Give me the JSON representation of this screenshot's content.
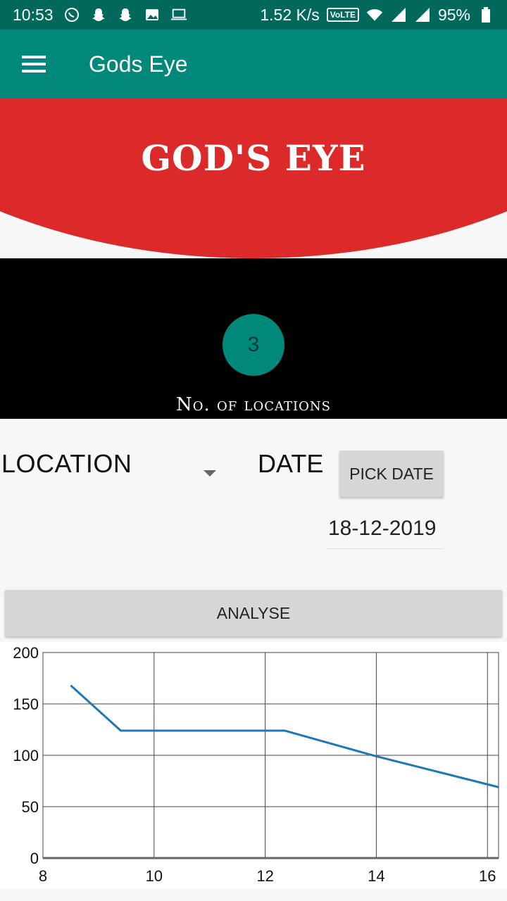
{
  "status_bar": {
    "time": "10:53",
    "speed": "1.52 K/s",
    "volte": "VoLTE",
    "battery": "95%"
  },
  "app_bar": {
    "title": "Gods Eye",
    "menu_icon": "hamburger-menu-icon"
  },
  "banner": {
    "title": "GOD'S EYE",
    "color": "#dc2a2a"
  },
  "summary": {
    "count": "3",
    "label": "No. of locations"
  },
  "form": {
    "location_label": "LOCATION",
    "date_label": "DATE",
    "pick_date_label": "PICK DATE",
    "date_value": "18-12-2019",
    "analyse_label": "ANALYSE"
  },
  "colors": {
    "primary": "#00897b",
    "primary_dark": "#00695c",
    "accent_red": "#dc2a2a",
    "line": "#1f77b4"
  },
  "chart_data": {
    "type": "line",
    "x": [
      8.5,
      9.4,
      12.35,
      14,
      16.2
    ],
    "y": [
      168,
      124,
      124,
      99,
      69
    ],
    "xlim": [
      8,
      16.2
    ],
    "ylim": [
      0,
      200
    ],
    "x_ticks": [
      "8",
      "10",
      "12",
      "14",
      "16"
    ],
    "y_ticks": [
      "0",
      "50",
      "100",
      "150",
      "200"
    ],
    "grid": true
  }
}
